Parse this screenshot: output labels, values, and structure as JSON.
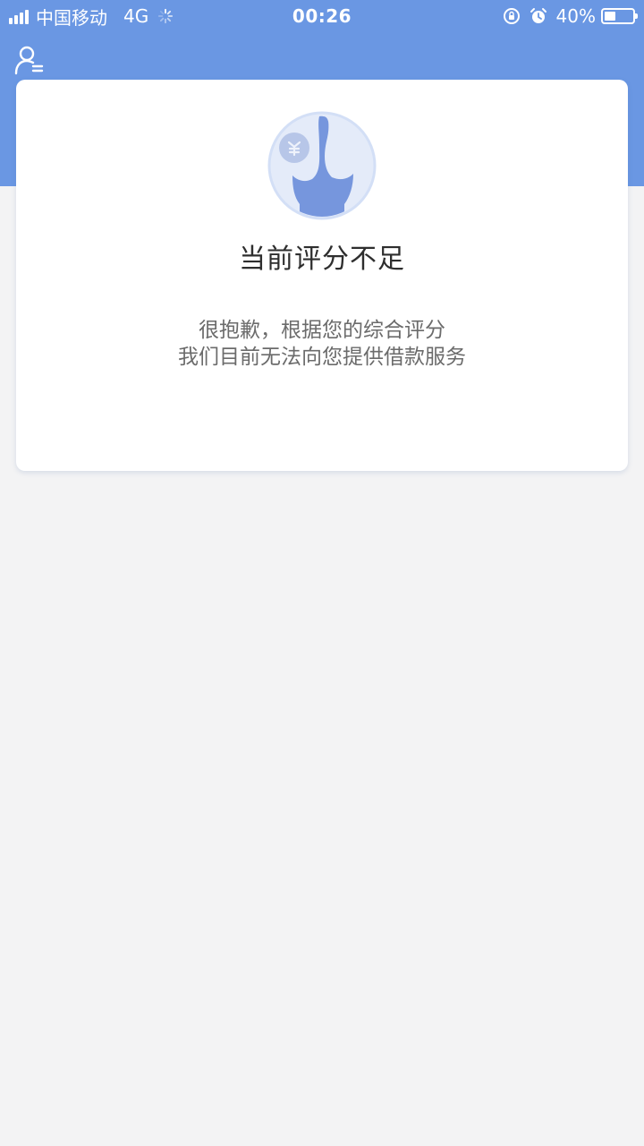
{
  "status_bar": {
    "carrier": "中国移动",
    "network": "4G",
    "time": "00:26",
    "battery": "40%",
    "battery_level": 0.4,
    "icons": [
      "signal-icon",
      "loading-icon",
      "rotation-lock-icon",
      "alarm-icon",
      "battery-icon"
    ]
  },
  "header": {
    "user_icon": "user-menu-icon",
    "background_color": "#6a97e3"
  },
  "card": {
    "illustration": "empty-state-illustration",
    "title": "当前评分不足",
    "message_line1": "很抱歉，根据您的综合评分",
    "message_line2": "我们目前无法向您提供借款服务"
  },
  "colors": {
    "accent": "#6a97e3",
    "page_background": "#f3f3f4",
    "card_background": "#ffffff"
  }
}
